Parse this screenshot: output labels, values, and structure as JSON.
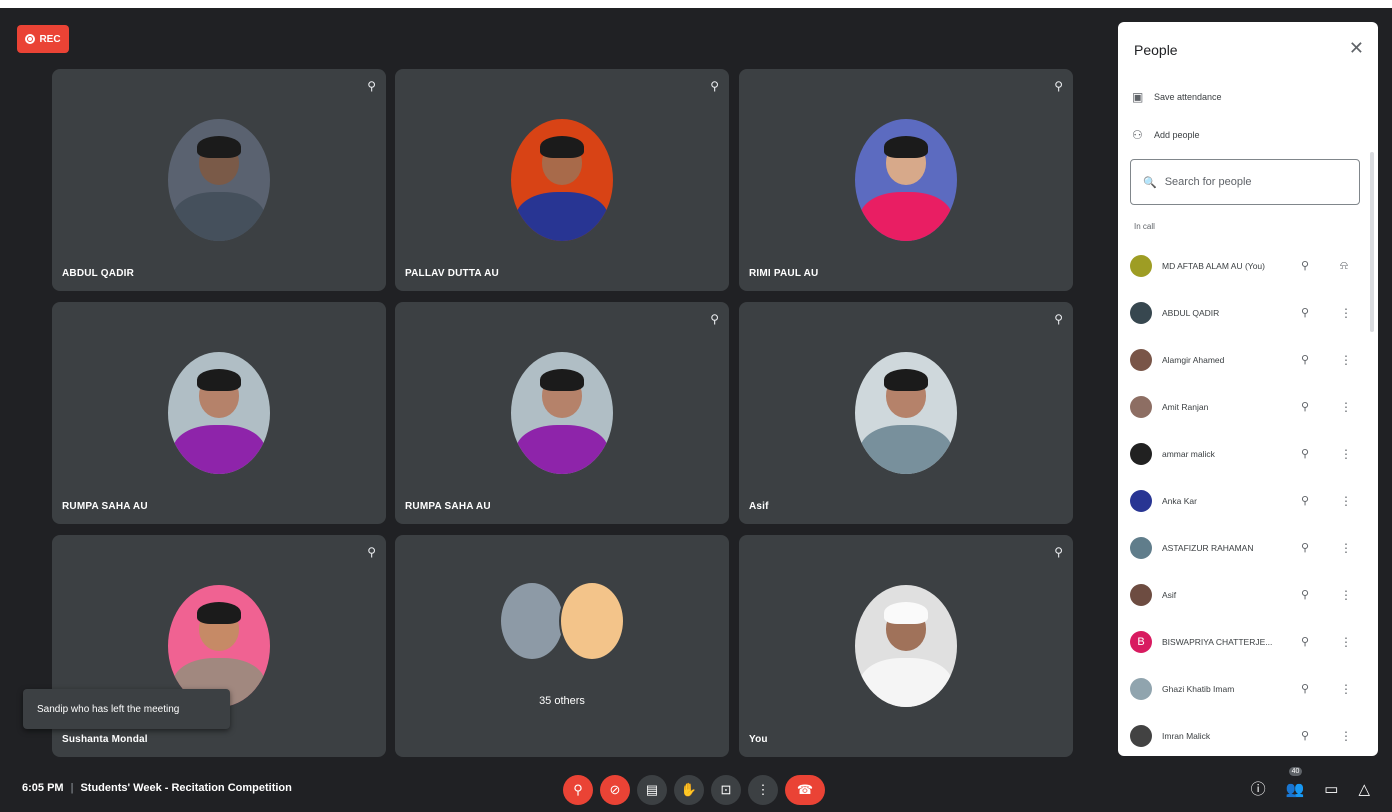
{
  "recording": {
    "label": "REC"
  },
  "tiles": [
    {
      "name": "ABDUL QADIR",
      "muted": true
    },
    {
      "name": "PALLAV DUTTA AU",
      "muted": true
    },
    {
      "name": "RIMI PAUL AU",
      "muted": true
    },
    {
      "name": "RUMPA SAHA AU",
      "muted": false
    },
    {
      "name": "RUMPA SAHA AU",
      "muted": true
    },
    {
      "name": "Asif",
      "muted": true
    },
    {
      "name": "Sushanta Mondal",
      "muted": true
    },
    {
      "name": "",
      "others_label": "35 others"
    },
    {
      "name": "You",
      "muted": true
    }
  ],
  "toast": {
    "message": "Sandip who has left the meeting"
  },
  "meeting": {
    "time": "6:05 PM",
    "title": "Students' Week - Recitation Competition"
  },
  "controls": {
    "mic_icon": "mic-off-icon",
    "camera_icon": "camera-off-icon",
    "captions_icon": "captions-icon",
    "hand_icon": "raise-hand-icon",
    "present_icon": "present-icon",
    "more_icon": "more-vert-icon",
    "end_icon": "end-call-icon"
  },
  "right_toolbar": {
    "participants_count": "40"
  },
  "people_panel": {
    "title": "People",
    "save_attendance": "Save attendance",
    "add_people": "Add people",
    "search_placeholder": "Search for people",
    "section_label": "In call",
    "participants": [
      {
        "name": "MD AFTAB ALAM AU (You)",
        "avatar_color": "#9e9d24"
      },
      {
        "name": "ABDUL QADIR",
        "avatar_color": "#37474f"
      },
      {
        "name": "Alamgir Ahamed",
        "avatar_color": "#795548"
      },
      {
        "name": "Amit Ranjan",
        "avatar_color": "#8d6e63"
      },
      {
        "name": "ammar malick",
        "avatar_color": "#212121"
      },
      {
        "name": "Anka Kar",
        "avatar_color": "#283593"
      },
      {
        "name": "ASTAFIZUR RAHAMAN",
        "avatar_color": "#607d8b"
      },
      {
        "name": "Asif",
        "avatar_color": "#6d4c41"
      },
      {
        "name": "BISWAPRIYA CHATTERJE...",
        "avatar_color": "#d81b60",
        "initial": "B"
      },
      {
        "name": "Ghazi Khatib Imam",
        "avatar_color": "#90a4ae"
      },
      {
        "name": "Imran Malick",
        "avatar_color": "#424242"
      }
    ]
  },
  "colors": {
    "background": "#202124",
    "tile": "#3c4043",
    "danger": "#ea4335",
    "panel": "#ffffff"
  }
}
